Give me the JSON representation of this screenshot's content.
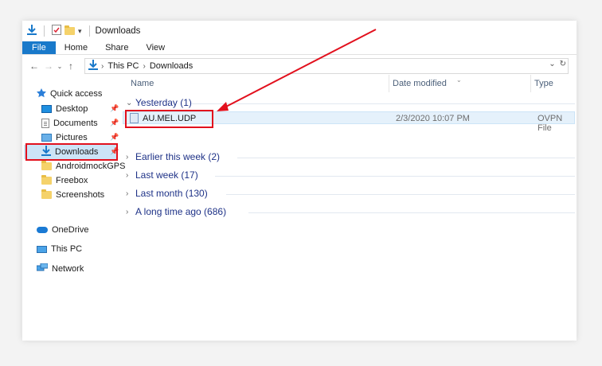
{
  "window": {
    "title": "Downloads",
    "qa_icons": [
      "download-arrow-icon",
      "properties-icon",
      "new-folder-icon",
      "customize-dropdown-icon"
    ]
  },
  "ribbon": {
    "tabs": [
      {
        "label": "File",
        "active": true
      },
      {
        "label": "Home"
      },
      {
        "label": "Share"
      },
      {
        "label": "View"
      }
    ]
  },
  "address": {
    "crumbs": [
      "This PC",
      "Downloads"
    ]
  },
  "nav": {
    "quick_access": "Quick access",
    "items": [
      {
        "label": "Desktop",
        "icon": "desktop-icon",
        "pinned": true
      },
      {
        "label": "Documents",
        "icon": "documents-icon",
        "pinned": true
      },
      {
        "label": "Pictures",
        "icon": "pictures-icon",
        "pinned": true
      },
      {
        "label": "Downloads",
        "icon": "downloads-icon",
        "pinned": true,
        "selected": true
      },
      {
        "label": "AndroidmockGPS",
        "icon": "folder-icon"
      },
      {
        "label": "Freebox",
        "icon": "folder-icon"
      },
      {
        "label": "Screenshots",
        "icon": "folder-icon"
      }
    ],
    "onedrive": "OneDrive",
    "thispc": "This PC",
    "network": "Network"
  },
  "columns": {
    "name": "Name",
    "date": "Date modified",
    "type": "Type"
  },
  "groups": [
    {
      "label": "Yesterday (1)",
      "expanded": true
    },
    {
      "label": "Earlier this week (2)",
      "expanded": false
    },
    {
      "label": "Last week (17)",
      "expanded": false
    },
    {
      "label": "Last month (130)",
      "expanded": false
    },
    {
      "label": "A long time ago (686)",
      "expanded": false
    }
  ],
  "files": [
    {
      "name": "AU.MEL.UDP",
      "date": "2/3/2020 10:07 PM",
      "type": "OVPN File"
    }
  ],
  "colors": {
    "accent": "#1979ca",
    "group_text": "#1e3287",
    "annotation": "#e2101d",
    "selection": "#cce4f7"
  }
}
